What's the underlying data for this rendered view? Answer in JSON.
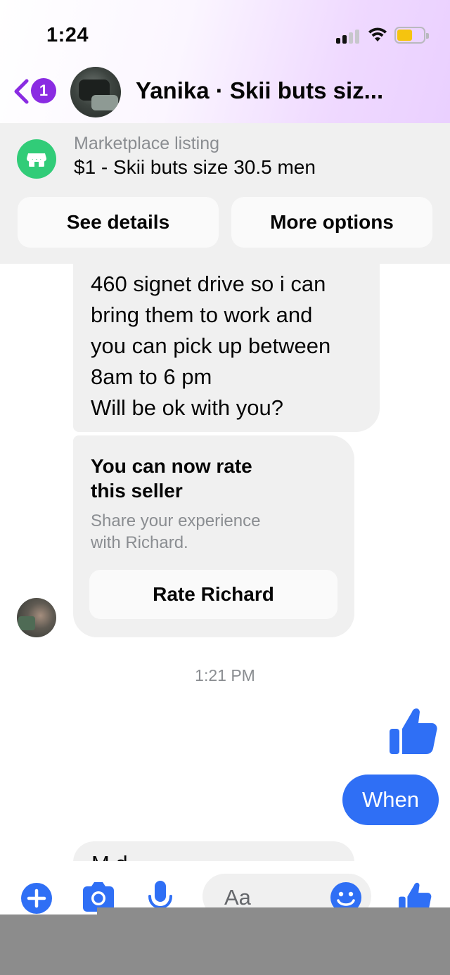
{
  "status_bar": {
    "time": "1:24"
  },
  "header": {
    "unread_count": "1",
    "title": "Yanika · Skii buts siz..."
  },
  "listing": {
    "label": "Marketplace listing",
    "value": "$1 - Skii buts size 30.5 men",
    "see_details": "See details",
    "more_options": "More options"
  },
  "messages": {
    "incoming_lines": [
      "460 signet drive so i can",
      "bring them to work and",
      "you can pick up between",
      "8am to 6 pm",
      "Will be ok with you?"
    ],
    "rate_card": {
      "title_line1": "You can now rate",
      "title_line2": "this seller",
      "subtitle_line1": "Share your experience",
      "subtitle_line2": "with Richard.",
      "button": "Rate Richard"
    },
    "timestamp": "1:21 PM",
    "outgoing_text": "When",
    "partial_text": "M      d"
  },
  "composer": {
    "placeholder": "Aa"
  },
  "colors": {
    "accent_purple": "#8a2be2",
    "messenger_blue": "#2f6ff5",
    "marketplace_green": "#31cc78",
    "bubble_gray": "#f0f0f0"
  },
  "icons": [
    "back-chevron-icon",
    "marketplace-shop-icon",
    "thumbs-up-icon",
    "plus-icon",
    "camera-icon",
    "microphone-icon",
    "emoji-icon"
  ]
}
